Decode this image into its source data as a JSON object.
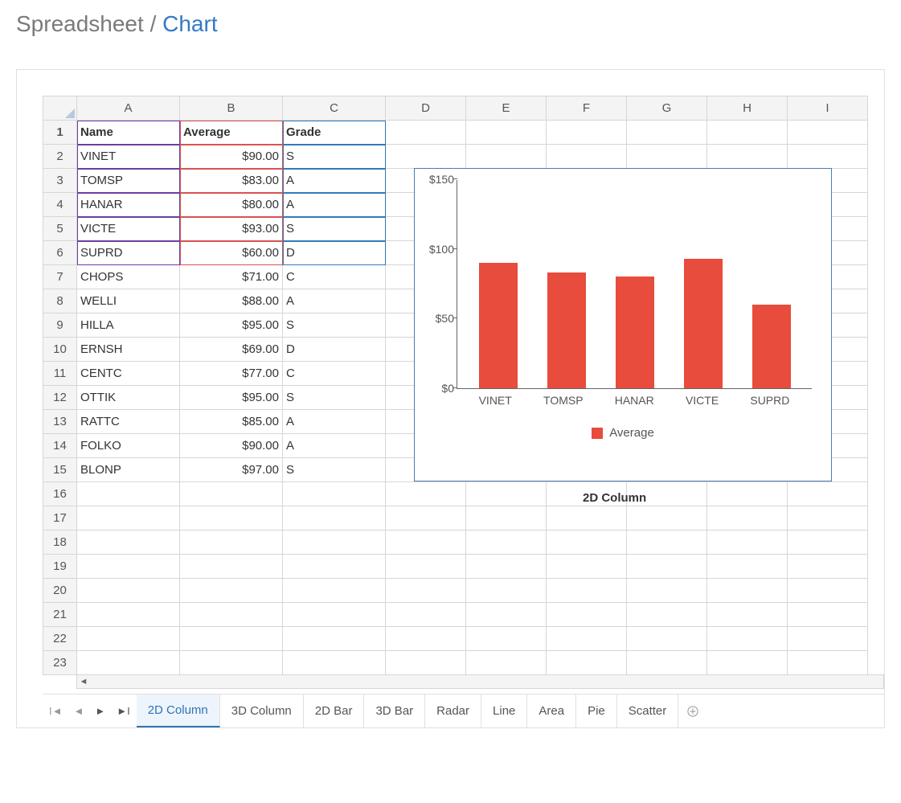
{
  "breadcrumb": {
    "root": "Spreadsheet",
    "sep": " / ",
    "current": "Chart"
  },
  "columns": [
    "A",
    "B",
    "C",
    "D",
    "E",
    "F",
    "G",
    "H",
    "I"
  ],
  "headers": {
    "A": "Name",
    "B": "Average",
    "C": "Grade"
  },
  "rows": [
    {
      "n": 1,
      "A": "Name",
      "B": "Average",
      "C": "Grade"
    },
    {
      "n": 2,
      "A": "VINET",
      "B": "$90.00",
      "C": "S"
    },
    {
      "n": 3,
      "A": "TOMSP",
      "B": "$83.00",
      "C": "A"
    },
    {
      "n": 4,
      "A": "HANAR",
      "B": "$80.00",
      "C": "A"
    },
    {
      "n": 5,
      "A": "VICTE",
      "B": "$93.00",
      "C": "S"
    },
    {
      "n": 6,
      "A": "SUPRD",
      "B": "$60.00",
      "C": "D"
    },
    {
      "n": 7,
      "A": "CHOPS",
      "B": "$71.00",
      "C": "C"
    },
    {
      "n": 8,
      "A": "WELLI",
      "B": "$88.00",
      "C": "A"
    },
    {
      "n": 9,
      "A": "HILLA",
      "B": "$95.00",
      "C": "S"
    },
    {
      "n": 10,
      "A": "ERNSH",
      "B": "$69.00",
      "C": "D"
    },
    {
      "n": 11,
      "A": "CENTC",
      "B": "$77.00",
      "C": "C"
    },
    {
      "n": 12,
      "A": "OTTIK",
      "B": "$95.00",
      "C": "S"
    },
    {
      "n": 13,
      "A": "RATTC",
      "B": "$85.00",
      "C": "A"
    },
    {
      "n": 14,
      "A": "FOLKO",
      "B": "$90.00",
      "C": "A"
    },
    {
      "n": 15,
      "A": "BLONP",
      "B": "$97.00",
      "C": "S"
    }
  ],
  "blank_rows": [
    16,
    17,
    18,
    19,
    20,
    21,
    22,
    23
  ],
  "chart_caption": "2D Column",
  "chart_data": {
    "type": "bar",
    "categories": [
      "VINET",
      "TOMSP",
      "HANAR",
      "VICTE",
      "SUPRD"
    ],
    "values": [
      90,
      83,
      80,
      93,
      60
    ],
    "series_name": "Average",
    "yticks": [
      0,
      50,
      100,
      150
    ],
    "ytick_labels": [
      "$0",
      "$50",
      "$100",
      "$150"
    ],
    "ylim": [
      0,
      150
    ],
    "color": "#e74c3c",
    "legend": "Average"
  },
  "tabs": [
    "2D Column",
    "3D Column",
    "2D Bar",
    "3D Bar",
    "Radar",
    "Line",
    "Area",
    "Pie",
    "Scatter"
  ],
  "active_tab": "2D Column"
}
